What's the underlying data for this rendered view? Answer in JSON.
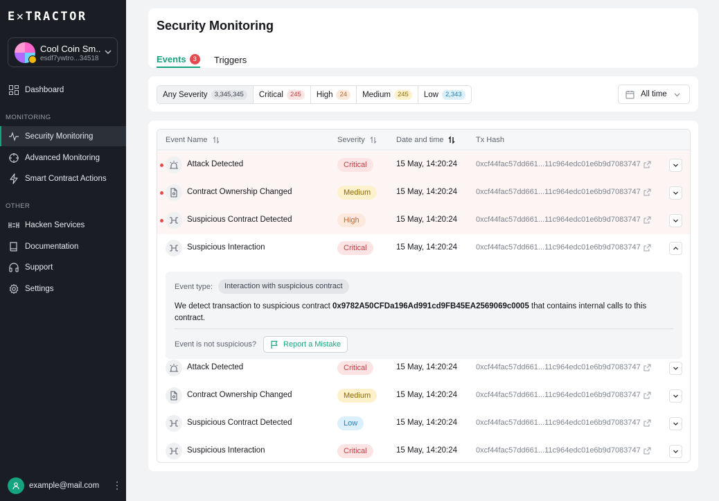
{
  "app": {
    "logo": "E✕TRACTOR"
  },
  "project": {
    "name": "Cool Coin Sm..",
    "address": "esdf7ywtro...34518"
  },
  "nav": {
    "dashboard": "Dashboard",
    "section_monitoring": "MONITORING",
    "security_monitoring": "Security Monitoring",
    "advanced_monitoring": "Advanced Monitoring",
    "smart_contract_actions": "Smart Contract Actions",
    "section_other": "OTHER",
    "hacken_services": "Hacken Services",
    "documentation": "Documentation",
    "support": "Support",
    "settings": "Settings"
  },
  "user": {
    "email": "example@mail.com"
  },
  "page": {
    "title": "Security Monitoring",
    "tabs": [
      {
        "label": "Events",
        "count": "3"
      },
      {
        "label": "Triggers"
      }
    ]
  },
  "filters": {
    "severity": [
      {
        "label": "Any Severity",
        "count": "3,345,345"
      },
      {
        "label": "Critical",
        "count": "245"
      },
      {
        "label": "High",
        "count": "24"
      },
      {
        "label": "Medium",
        "count": "245"
      },
      {
        "label": "Low",
        "count": "2,343"
      }
    ],
    "time": "All time"
  },
  "table": {
    "headers": {
      "name": "Event Name",
      "severity": "Severity",
      "date": "Date and time",
      "hash": "Tx Hash"
    },
    "rows": [
      {
        "name": "Attack Detected",
        "severity": "Critical",
        "date": "15 May, 14:20:24",
        "hash": "0xcf44fac57dd661...11c964edc01e6b9d7083747"
      },
      {
        "name": "Contract Ownership Changed",
        "severity": "Medium",
        "date": "15 May, 14:20:24",
        "hash": "0xcf44fac57dd661...11c964edc01e6b9d7083747"
      },
      {
        "name": "Suspicious Contract Detected",
        "severity": "High",
        "date": "15 May, 14:20:24",
        "hash": "0xcf44fac57dd661...11c964edc01e6b9d7083747"
      },
      {
        "name": "Suspicious Interaction",
        "severity": "Critical",
        "date": "15 May, 14:20:24",
        "hash": "0xcf44fac57dd661...11c964edc01e6b9d7083747"
      },
      {
        "name": "Attack Detected",
        "severity": "Critical",
        "date": "15 May, 14:20:24",
        "hash": "0xcf44fac57dd661...11c964edc01e6b9d7083747"
      },
      {
        "name": "Contract Ownership Changed",
        "severity": "Medium",
        "date": "15 May, 14:20:24",
        "hash": "0xcf44fac57dd661...11c964edc01e6b9d7083747"
      },
      {
        "name": "Suspicious Contract Detected",
        "severity": "Low",
        "date": "15 May, 14:20:24",
        "hash": "0xcf44fac57dd661...11c964edc01e6b9d7083747"
      },
      {
        "name": "Suspicious Interaction",
        "severity": "Critical",
        "date": "15 May, 14:20:24",
        "hash": "0xcf44fac57dd661...11c964edc01e6b9d7083747"
      }
    ],
    "detail": {
      "type_label": "Event type:",
      "type_value": "Interaction with suspicious contract",
      "text_before": "We detect transaction to suspicious contract ",
      "address": "0x9782A50CFDa196Ad991cd9FB45EA2569069c0005",
      "text_after": " that contains internal calls to this contract.",
      "question": "Event is not suspicious?",
      "report_label": "Report a Mistake"
    }
  },
  "colors": {
    "accent": "#16a37f",
    "sidebar_bg": "#1a1d23",
    "critical": "#c13e3e",
    "unread_dot": "#e5484d"
  }
}
